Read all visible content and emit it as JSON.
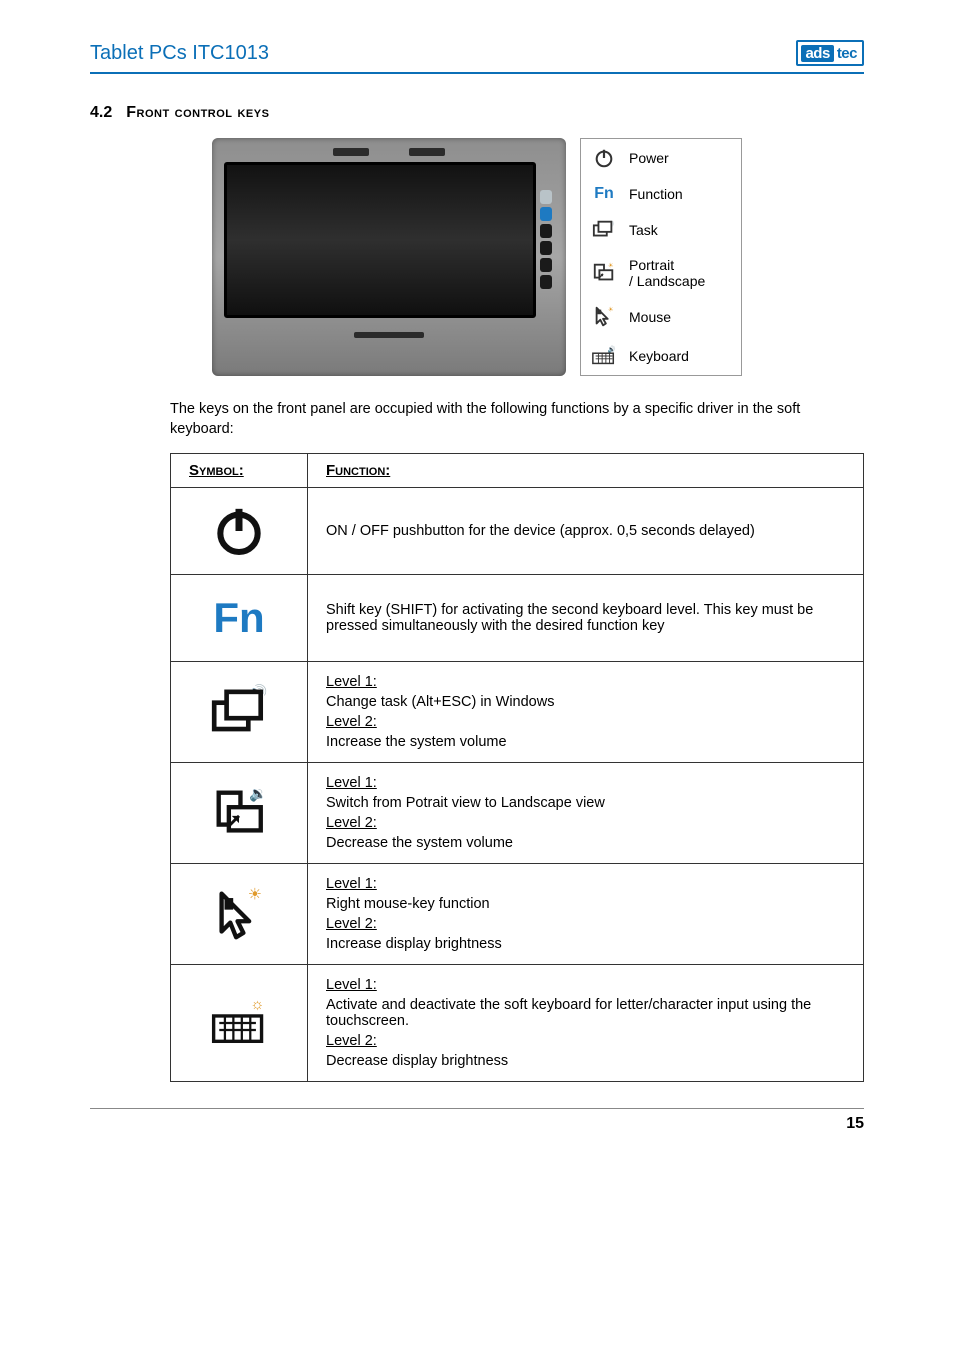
{
  "header": {
    "title": "Tablet PCs ITC1013",
    "logo_a": "ads",
    "logo_b": "tec"
  },
  "section": {
    "num": "4.2",
    "title": "Front control keys"
  },
  "legend": [
    {
      "icon": "power-icon",
      "label": "Power"
    },
    {
      "icon": "fn-icon",
      "label": "Function"
    },
    {
      "icon": "task-icon",
      "label": "Task"
    },
    {
      "icon": "rotate-icon",
      "label": "Portrait\n/ Landscape"
    },
    {
      "icon": "mouse-icon",
      "label": "Mouse"
    },
    {
      "icon": "keyboard-icon",
      "label": "Keyboard"
    }
  ],
  "intro": "The keys on the front panel are occupied with the following functions by a specific driver in the soft keyboard:",
  "table": {
    "head_symbol": "Symbol:",
    "head_function": "Function:",
    "rows": [
      {
        "icon": "power-icon",
        "body": "ON / OFF pushbutton for the device (approx. 0,5 seconds delayed)"
      },
      {
        "icon": "fn-icon",
        "body": "Shift key (SHIFT) for activating the second keyboard level. This key must be pressed simultaneously with the desired function key"
      },
      {
        "icon": "task-icon",
        "l1": "Change task (Alt+ESC) in Windows",
        "l2": "Increase the system volume"
      },
      {
        "icon": "rotate-icon",
        "l1": "Switch from Potrait view to Landscape view",
        "l2": "Decrease the system volume"
      },
      {
        "icon": "mouse-icon",
        "l1": "Right mouse-key function",
        "l2": "Increase display brightness"
      },
      {
        "icon": "keyboard-icon",
        "l1": "Activate and deactivate the soft keyboard for letter/character input using the touchscreen.",
        "l2": "Decrease display brightness"
      }
    ],
    "level1_label": "Level 1:",
    "level2_label": "Level 2:"
  },
  "page_num": "15"
}
